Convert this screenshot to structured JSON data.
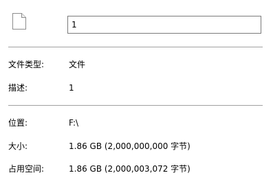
{
  "header": {
    "icon": "file-icon",
    "name_value": "1"
  },
  "general": {
    "type_label": "文件类型:",
    "type_value": "文件",
    "description_label": "描述:",
    "description_value": "1"
  },
  "details": {
    "location_label": "位置:",
    "location_value": "F:\\",
    "size_label": "大小:",
    "size_value": "1.86 GB (2,000,000,000 字节)",
    "size_on_disk_label": "占用空间:",
    "size_on_disk_value": "1.86 GB (2,000,003,072 字节)"
  },
  "colors": {
    "divider": "#a0a0a0",
    "field_border": "#7a7a7a"
  }
}
